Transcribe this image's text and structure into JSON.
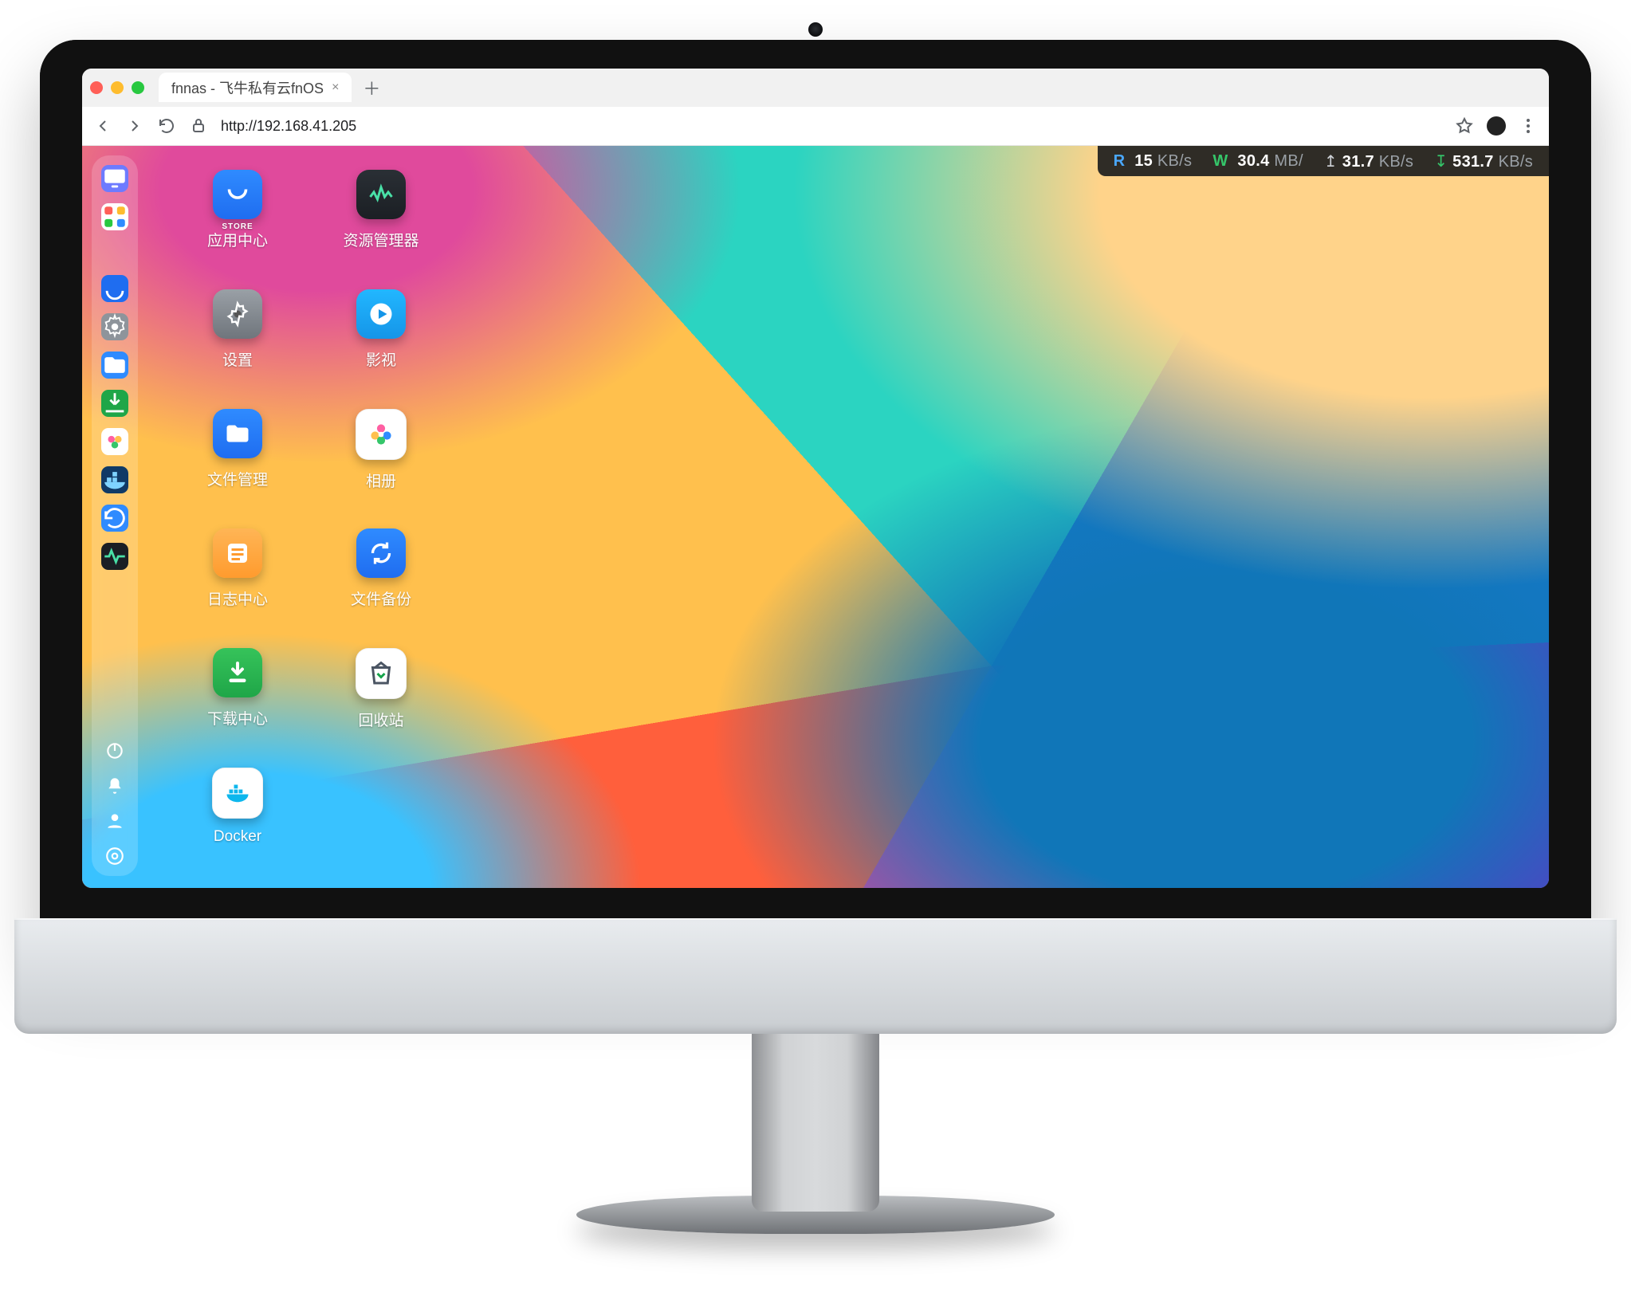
{
  "browser": {
    "tab_title": "fnnas - 飞牛私有云fnOS",
    "url": "http://192.168.41.205"
  },
  "netstats": {
    "read": {
      "label": "R",
      "value": "15",
      "unit": "KB/s"
    },
    "write": {
      "label": "W",
      "value": "30.4",
      "unit": "MB/"
    },
    "upload": {
      "icon": "↥",
      "value": "31.7",
      "unit": "KB/s"
    },
    "download": {
      "icon": "↧",
      "value": "531.7",
      "unit": "KB/s"
    }
  },
  "dock": {
    "items": [
      {
        "name": "desktop-icon"
      },
      {
        "name": "apps-grid-icon"
      },
      {
        "name": "store-icon"
      },
      {
        "name": "settings-icon"
      },
      {
        "name": "files-icon"
      },
      {
        "name": "downloads-icon"
      },
      {
        "name": "photos-icon"
      },
      {
        "name": "docker-icon"
      },
      {
        "name": "backup-icon"
      },
      {
        "name": "monitor-icon"
      }
    ],
    "bottom": [
      {
        "name": "power-icon"
      },
      {
        "name": "notifications-icon"
      },
      {
        "name": "user-icon"
      },
      {
        "name": "system-settings-icon"
      }
    ]
  },
  "apps": [
    {
      "id": "app-store",
      "label": "应用中心",
      "tile": "t-blue",
      "icon": "smile",
      "badge": "STORE"
    },
    {
      "id": "resource-mgr",
      "label": "资源管理器",
      "tile": "t-dark",
      "icon": "wave"
    },
    {
      "id": "settings",
      "label": "设置",
      "tile": "t-gray",
      "icon": "gear"
    },
    {
      "id": "media",
      "label": "影视",
      "tile": "t-cyan",
      "icon": "play"
    },
    {
      "id": "file-mgr",
      "label": "文件管理",
      "tile": "t-blue",
      "icon": "folder"
    },
    {
      "id": "album",
      "label": "相册",
      "tile": "t-white",
      "icon": "flower"
    },
    {
      "id": "log-center",
      "label": "日志中心",
      "tile": "t-orange",
      "icon": "list"
    },
    {
      "id": "file-backup",
      "label": "文件备份",
      "tile": "t-blue",
      "icon": "sync"
    },
    {
      "id": "download",
      "label": "下载中心",
      "tile": "t-green",
      "icon": "down"
    },
    {
      "id": "recycle",
      "label": "回收站",
      "tile": "t-white",
      "icon": "recycle"
    },
    {
      "id": "docker",
      "label": "Docker",
      "tile": "t-white",
      "icon": "whale"
    }
  ]
}
